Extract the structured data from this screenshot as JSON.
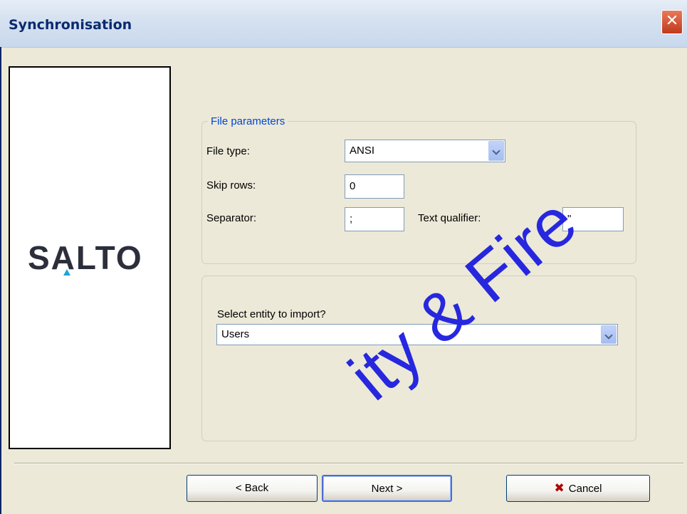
{
  "window": {
    "title": "Synchronisation",
    "close_glyph": "✕"
  },
  "logo": {
    "text": "SALTO",
    "accent_color": "#1aa6d6"
  },
  "file_parameters": {
    "legend": "File parameters",
    "file_type_label": "File type:",
    "file_type_value": "ANSI",
    "skip_rows_label": "Skip rows:",
    "skip_rows_value": "0",
    "separator_label": "Separator:",
    "separator_value": ";",
    "text_qualifier_label": "Text qualifier:",
    "text_qualifier_value": "\""
  },
  "entity": {
    "prompt_label": "Select entity to import?",
    "selected_value": "Users"
  },
  "buttons": {
    "back_label": "< Back",
    "next_label": "Next >",
    "cancel_label": "Cancel",
    "cancel_icon": "cancel-x-icon"
  },
  "watermark": {
    "text": "ity & Fire"
  },
  "colors": {
    "dialog_bg": "#ece9d8",
    "title_text": "#0a2a6e",
    "legend_text": "#0046d5",
    "close_button": "#c0391b",
    "watermark": "#1d1de0"
  }
}
